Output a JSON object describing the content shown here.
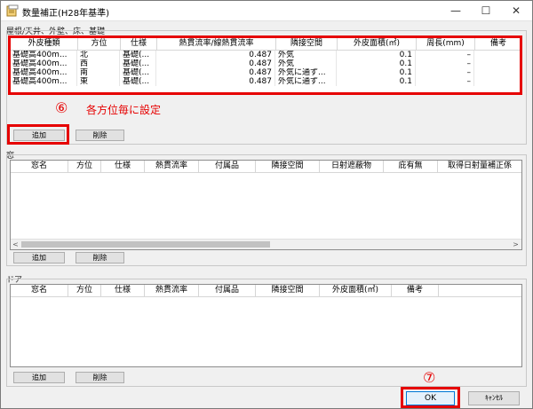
{
  "window": {
    "title": "数量補正(H28年基準)",
    "minimize_glyph": "—",
    "maximize_glyph": "☐",
    "close_glyph": "✕"
  },
  "roof": {
    "label": "屋根/天井、外壁、床、基礎",
    "columns": [
      "外皮種類",
      "方位",
      "仕様",
      "熱貫流率/線熱貫流率",
      "隣接空間",
      "外皮面積(㎡)",
      "周長(mm)",
      "備考"
    ],
    "rows": [
      [
        "基礎高400m...",
        "北",
        "基礎(...",
        "0.487",
        "外気",
        "0.1",
        "–",
        ""
      ],
      [
        "基礎高400m...",
        "西",
        "基礎(...",
        "0.487",
        "外気",
        "0.1",
        "–",
        ""
      ],
      [
        "基礎高400m...",
        "南",
        "基礎(...",
        "0.487",
        "外気に通ず...",
        "0.1",
        "–",
        ""
      ],
      [
        "基礎高400m...",
        "東",
        "基礎(...",
        "0.487",
        "外気に通ず...",
        "0.1",
        "–",
        ""
      ]
    ],
    "add_label": "追加",
    "delete_label": "削除"
  },
  "window_section": {
    "label": "窓",
    "columns": [
      "窓名",
      "方位",
      "仕様",
      "熱貫流率",
      "付属品",
      "隣接空間",
      "日射遮蔽物",
      "庇有無",
      "取得日射量補正係"
    ],
    "add_label": "追加",
    "delete_label": "削除"
  },
  "door": {
    "label": "ドア",
    "columns": [
      "窓名",
      "方位",
      "仕様",
      "熱貫流率",
      "付属品",
      "隣接空間",
      "外皮面積(㎡)",
      "備考"
    ],
    "add_label": "追加",
    "delete_label": "削除"
  },
  "footer": {
    "ok_label": "OK",
    "cancel_label": "ｷｬﾝｾﾙ"
  },
  "annotations": {
    "marker6": "⑥",
    "note6": "各方位毎に設定",
    "marker7": "⑦",
    "color": "#e60000"
  }
}
